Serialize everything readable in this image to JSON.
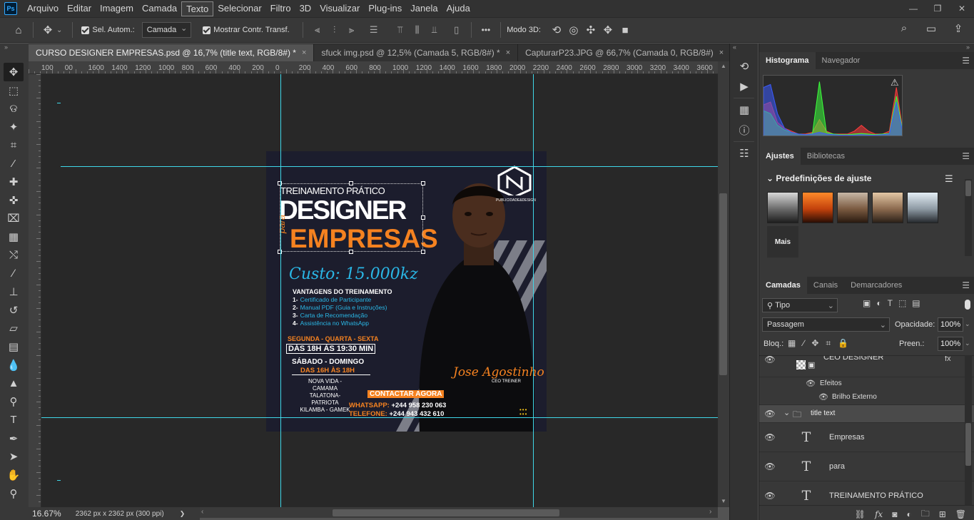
{
  "app": {
    "logo": "Ps"
  },
  "menu": [
    "Arquivo",
    "Editar",
    "Imagem",
    "Camada",
    "Texto",
    "Selecionar",
    "Filtro",
    "3D",
    "Visualizar",
    "Plug-ins",
    "Janela",
    "Ajuda"
  ],
  "window_controls": [
    "—",
    "❐",
    "✕"
  ],
  "options": {
    "auto_select_label": "Sel. Autom.:",
    "auto_select_value": "Camada",
    "show_transform_label": "Mostrar Contr. Transf.",
    "more": "•••",
    "mode3d_label": "Modo 3D:"
  },
  "tabs": [
    {
      "label": "CURSO DESIGNER EMPRESAS.psd @ 16,7% (title text, RGB/8#) *",
      "close": "×"
    },
    {
      "label": "sfuck img.psd @ 12,5% (Camada 5, RGB/8#) *",
      "close": "×"
    },
    {
      "label": "CapturarP23.JPG @ 66,7% (Camada 0, RGB/8#)",
      "close": "×"
    }
  ],
  "ruler_labels": [
    "100",
    "00",
    "1600",
    "1400",
    "1200",
    "1000",
    "800",
    "600",
    "400",
    "200",
    "0",
    "200",
    "400",
    "600",
    "800",
    "1000",
    "1200",
    "1400",
    "1600",
    "1800",
    "2000",
    "2200",
    "2400",
    "2600",
    "2800",
    "3000",
    "3200",
    "3400",
    "3600"
  ],
  "status": {
    "zoom": "16.67%",
    "doc_info": "2362 px x 2362 px (300 ppi)",
    "arrow": "❯"
  },
  "artwork": {
    "tag": "TREINAMENTO PRÁTICO",
    "title1": "DESIGNER",
    "title_para": "para",
    "title2": "EMPRESAS",
    "logo_sub": "PUBLICIDADE&DESIGN",
    "price": "Custo: 15.000kz",
    "advantages_title": "VANTAGENS DO TREINAMENTO",
    "advantages": [
      {
        "n": "1-",
        "t": "Certificado de Participante"
      },
      {
        "n": "2-",
        "t": "Manual PDF (Guia e Instruções)"
      },
      {
        "n": "3-",
        "t": "Carta de Recomendação"
      },
      {
        "n": "4-",
        "t": "Assistência no WhatsApp"
      }
    ],
    "days1": "SEGUNDA - QUARTA - SEXTA",
    "hours1": "DÁS 18H ÀS 19:30 MIN",
    "days2": "SÁBADO - DOMINGO",
    "hours2": "DAS 16H ÀS 18H",
    "locations": [
      "NOVA VIDA - CAMAMA",
      "TALATONA- PATRIOTA",
      "KILAMBA - GAMEK"
    ],
    "cta": "CONTACTAR AGORA",
    "whatsapp_label": "WHATSAPP:",
    "whatsapp": "+244 958 230 063",
    "phone_label": "TELEFONE:",
    "phone": "+244 943 432 610",
    "signature": "Jose Agostinho",
    "role": "CEO TREINER"
  },
  "panels": {
    "top_tabs": [
      "Histograma",
      "Navegador"
    ],
    "adj_tabs": [
      "Ajustes",
      "Bibliotecas"
    ],
    "adj_title": "Predefinições de ajuste",
    "adj_more": "Mais",
    "layer_tabs": [
      "Camadas",
      "Canais",
      "Demarcadores"
    ],
    "filter_kind": "Tipo",
    "blend_mode": "Passagem",
    "opacity_label": "Opacidade:",
    "opacity": "100%",
    "lock_label": "Bloq.:",
    "fill_label": "Preen.:",
    "fill": "100%",
    "layers": [
      {
        "name": "CEO DESIGNER",
        "kind": "smart"
      },
      {
        "name": "Efeitos",
        "kind": "effects"
      },
      {
        "name": "Brilho Externo",
        "kind": "effect"
      },
      {
        "name": "title text",
        "kind": "group"
      },
      {
        "name": "Empresas",
        "kind": "text"
      },
      {
        "name": "para",
        "kind": "text"
      },
      {
        "name": "TREINAMENTO PRÁTICO",
        "kind": "text"
      }
    ]
  },
  "colors": {
    "accent_orange": "#f58220",
    "accent_cyan": "#2ab7e6",
    "guide": "#3fd7e8",
    "bg_dark": "#1c1d2d"
  },
  "histogram_data": {
    "channels": [
      {
        "name": "red",
        "color": "#ff3b3b",
        "peaks": [
          0.55,
          0.6,
          0.25,
          0.15,
          0.1,
          0.05,
          0.05,
          0.08,
          0.3,
          0.1,
          0.05,
          0.05,
          0.05,
          0.1,
          0.2,
          0.1,
          0.05,
          0.05,
          0.1,
          0.85,
          0.05
        ]
      },
      {
        "name": "green",
        "color": "#3bff3b",
        "peaks": [
          0.45,
          0.4,
          0.2,
          0.12,
          0.08,
          0.05,
          0.04,
          0.06,
          0.95,
          0.08,
          0.05,
          0.04,
          0.04,
          0.05,
          0.06,
          0.05,
          0.04,
          0.05,
          0.06,
          0.7,
          0.04
        ]
      },
      {
        "name": "blue",
        "color": "#3b5bff",
        "peaks": [
          0.85,
          0.9,
          0.4,
          0.15,
          0.08,
          0.05,
          0.04,
          0.05,
          0.08,
          0.05,
          0.04,
          0.03,
          0.03,
          0.03,
          0.04,
          0.03,
          0.03,
          0.04,
          0.05,
          0.6,
          0.03
        ]
      }
    ]
  }
}
